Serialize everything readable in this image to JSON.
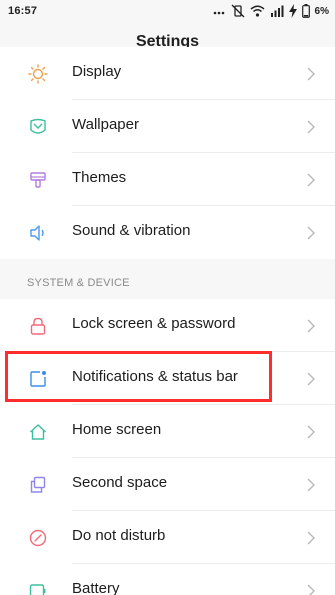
{
  "status_bar": {
    "time": "16:57",
    "battery_percent": "6%"
  },
  "header": {
    "title": "Settings"
  },
  "settings_top": [
    {
      "label": "Display",
      "icon": "sun-icon",
      "color": "#f0a04b"
    },
    {
      "label": "Wallpaper",
      "icon": "wallpaper-icon",
      "color": "#3bbf9e"
    },
    {
      "label": "Themes",
      "icon": "themes-icon",
      "color": "#b07ee0"
    },
    {
      "label": "Sound & vibration",
      "icon": "speaker-icon",
      "color": "#4a9be8"
    }
  ],
  "section": {
    "title": "SYSTEM & DEVICE"
  },
  "settings_system": [
    {
      "label": "Lock screen & password",
      "icon": "lock-icon",
      "color": "#f06a7a"
    },
    {
      "label": "Notifications & status bar",
      "icon": "notification-icon",
      "color": "#3a8ee6"
    },
    {
      "label": "Home screen",
      "icon": "home-icon",
      "color": "#3bbf9e"
    },
    {
      "label": "Second space",
      "icon": "second-space-icon",
      "color": "#8f86e8"
    },
    {
      "label": "Do not disturb",
      "icon": "do-not-disturb-icon",
      "color": "#f06a7a"
    },
    {
      "label": "Battery",
      "icon": "battery-icon",
      "color": "#3bbf9e"
    }
  ],
  "highlight": {
    "color": "#ff2d2d",
    "target": "Notifications & status bar"
  }
}
